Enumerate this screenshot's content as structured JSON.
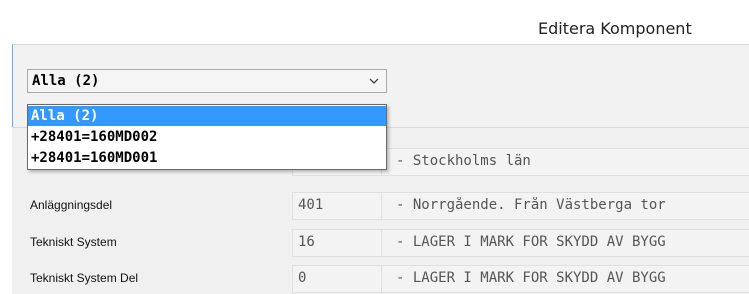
{
  "window": {
    "title": "Editera Komponent"
  },
  "combo": {
    "selected": "Alla (2)",
    "arrow_icon": "chevron-down-icon",
    "options": [
      {
        "label": "Alla (2)",
        "selected": true
      },
      {
        "label": "+28401=160MD002",
        "selected": false
      },
      {
        "label": "+28401=160MD001",
        "selected": false
      }
    ]
  },
  "rows": [
    {
      "label": "",
      "code": "",
      "description": "- Stockholms län"
    },
    {
      "label": "Anläggningsdel",
      "code": "401",
      "description": "- Norrgående. Från Västberga tor"
    },
    {
      "label": "Tekniskt System",
      "code": "16",
      "description": "- LAGER I MARK FÖR SKYDD AV BYGG"
    },
    {
      "label": "Tekniskt System Del",
      "code": "0",
      "description": "- LAGER I MARK FÖR SKYDD AV BYGG"
    }
  ],
  "colors": {
    "selection": "#3399ff",
    "window_edge": "#7aa7d9"
  }
}
